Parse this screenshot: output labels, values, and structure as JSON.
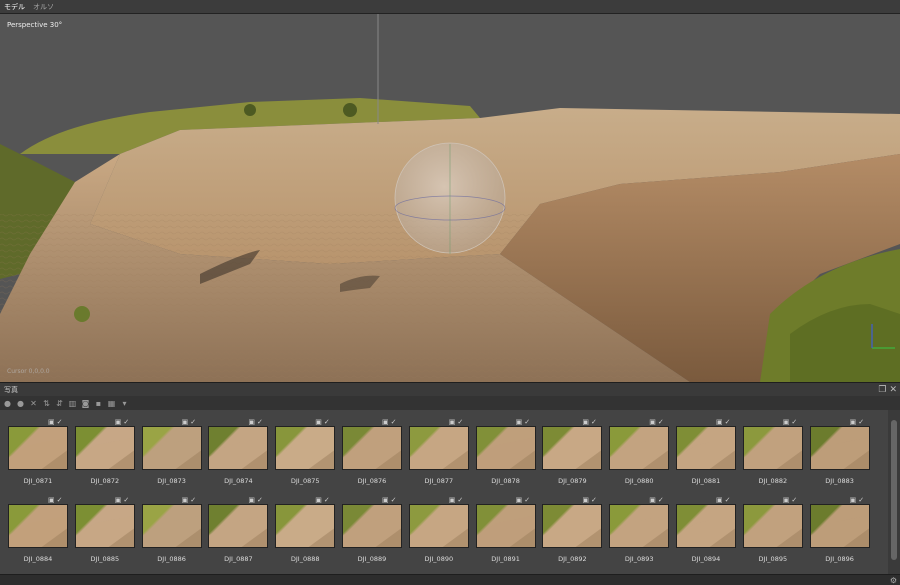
{
  "tabs": [
    {
      "label": "モデル",
      "active": true
    },
    {
      "label": "オルソ",
      "active": false
    }
  ],
  "viewport": {
    "projection_label": "Perspective 30°",
    "coords_text": "Cursor 0,0,0.0"
  },
  "photos_panel": {
    "title": "写真",
    "restore_icon": "restore-window-icon",
    "close_icon": "close-icon"
  },
  "toolbar": {
    "icons": [
      "add-icon",
      "remove-icon",
      "delete-icon",
      "sort-icon",
      "sort-desc-icon",
      "filter-icon",
      "mask-icon",
      "disable-icon",
      "view-mode-icon"
    ]
  },
  "photos": [
    {
      "name": "DJI_0871"
    },
    {
      "name": "DJI_0872"
    },
    {
      "name": "DJI_0873"
    },
    {
      "name": "DJI_0874"
    },
    {
      "name": "DJI_0875"
    },
    {
      "name": "DJI_0876"
    },
    {
      "name": "DJI_0877"
    },
    {
      "name": "DJI_0878"
    },
    {
      "name": "DJI_0879"
    },
    {
      "name": "DJI_0880"
    },
    {
      "name": "DJI_0881"
    },
    {
      "name": "DJI_0882"
    },
    {
      "name": "DJI_0883"
    },
    {
      "name": "DJI_0884"
    },
    {
      "name": "DJI_0885"
    },
    {
      "name": "DJI_0886"
    },
    {
      "name": "DJI_0887"
    },
    {
      "name": "DJI_0888"
    },
    {
      "name": "DJI_0889"
    },
    {
      "name": "DJI_0890"
    },
    {
      "name": "DJI_0891"
    },
    {
      "name": "DJI_0892"
    },
    {
      "name": "DJI_0893"
    },
    {
      "name": "DJI_0894"
    },
    {
      "name": "DJI_0895"
    },
    {
      "name": "DJI_0896"
    }
  ],
  "colors": {
    "background": "#555555",
    "terrain": "#c9a582",
    "grass": "#7a8a35",
    "panel": "#444444"
  }
}
